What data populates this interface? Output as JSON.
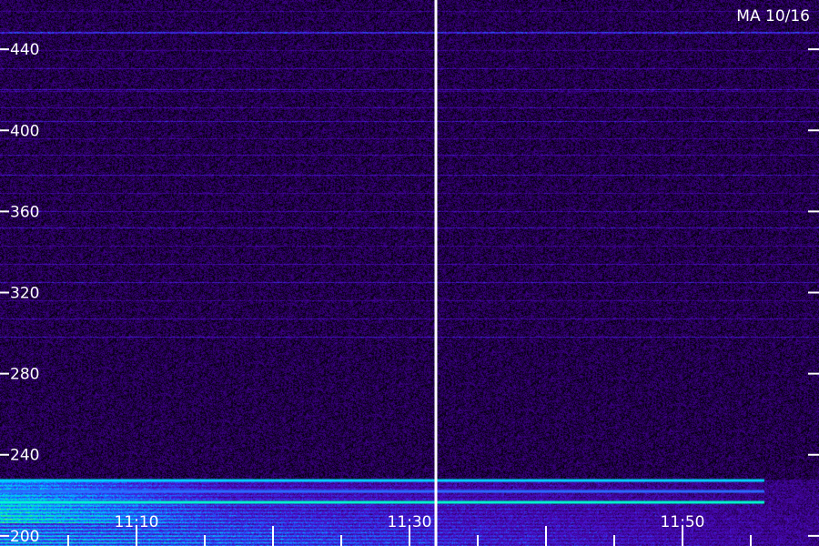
{
  "chart_data": {
    "type": "heatmap",
    "title": "MA 10/16",
    "xlabel": "",
    "ylabel": "",
    "y_ticks": [
      200,
      240,
      280,
      320,
      360,
      400,
      440
    ],
    "x_tick_labels": [
      "11:10",
      "11:30",
      "11:50"
    ],
    "x_range": [
      "11:00",
      "11:59"
    ],
    "y_range": [
      195,
      465
    ],
    "colormap": [
      "#000000",
      "#3a0080",
      "#4a10d0",
      "#1c5cff",
      "#00c8ff",
      "#00ff9a",
      "#8dff4a"
    ],
    "background": "#1a0033",
    "strong_band_top": 228
  }
}
